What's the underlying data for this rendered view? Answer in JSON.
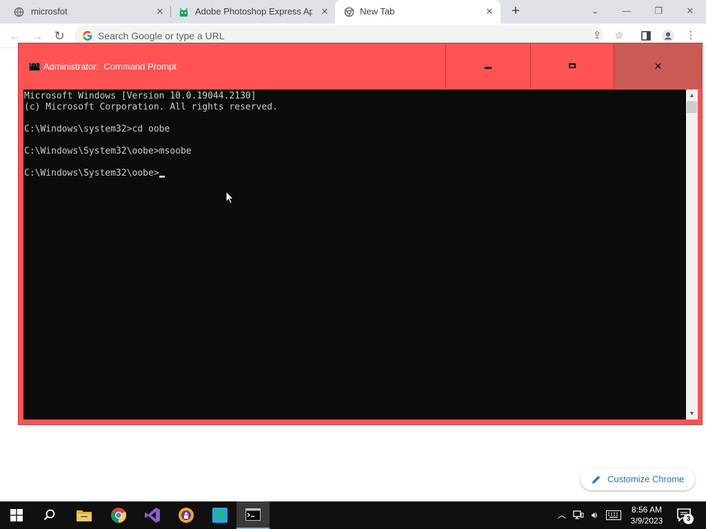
{
  "browser": {
    "tabs": [
      {
        "title": "microsfot",
        "icon": "globe-icon"
      },
      {
        "title": "Adobe Photoshop Express App |",
        "icon": "android-icon"
      },
      {
        "title": "New Tab",
        "icon": "chrome-icon"
      }
    ],
    "active_tab": 2,
    "omnibox_placeholder": "Search Google or type a URL"
  },
  "cmd_window": {
    "title": "Administrator:  Command Prompt",
    "lines": [
      "Microsoft Windows [Version 10.0.19044.2130]",
      "(c) Microsoft Corporation. All rights reserved.",
      "",
      "C:\\Windows\\system32>cd oobe",
      "",
      "C:\\Windows\\System32\\oobe>msoobe",
      "",
      "C:\\Windows\\System32\\oobe>"
    ],
    "colors": {
      "frame": "#ff5252",
      "close_button": "#c95a54",
      "console_bg": "#0c0c0c",
      "console_text": "#cccccc"
    }
  },
  "customize_chrome": {
    "label": "Customize Chrome"
  },
  "taskbar": {
    "apps": [
      "start-icon",
      "search-icon",
      "file-explorer-icon",
      "chrome-icon",
      "visual-studio-icon",
      "vpn-icon",
      "downloader-icon",
      "command-prompt-icon"
    ],
    "clock": {
      "time": "8:56 AM",
      "date": "3/9/2023"
    },
    "notification_count": "3"
  }
}
